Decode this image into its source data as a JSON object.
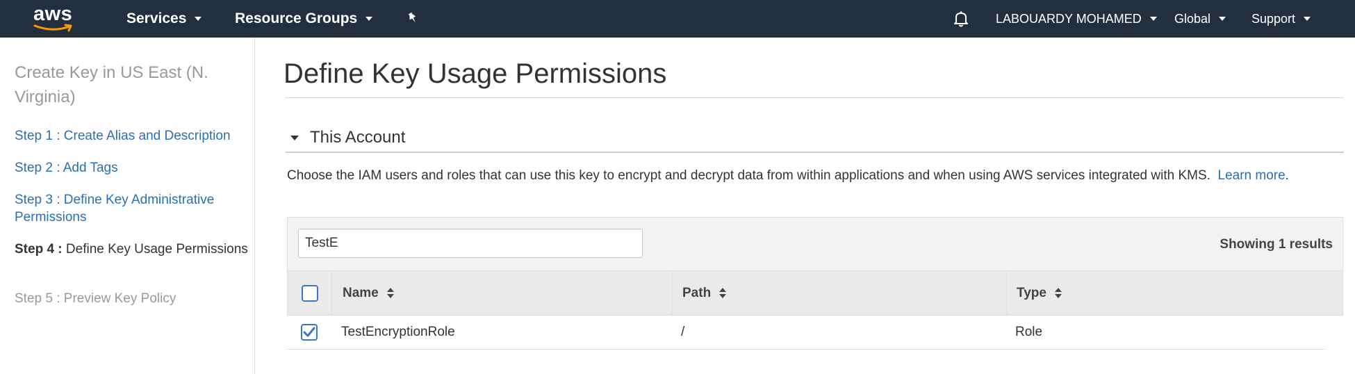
{
  "topbar": {
    "logo": "aws",
    "services": "Services",
    "resource_groups": "Resource Groups",
    "pin_icon": "pin-icon",
    "bell_icon": "bell-icon",
    "user": "LABOUARDY MOHAMED",
    "region": "Global",
    "support": "Support"
  },
  "sidebar": {
    "title": "Create Key in US East (N. Virginia)",
    "steps": [
      {
        "number": "Step 1 :",
        "label": "Create Alias and Description"
      },
      {
        "number": "Step 2 :",
        "label": "Add Tags"
      },
      {
        "number": "Step 3 :",
        "label": "Define Key Administrative Permissions"
      },
      {
        "number": "Step 4 :",
        "label": "Define Key Usage Permissions"
      },
      {
        "number": "Step 5 :",
        "label": "Preview Key Policy"
      }
    ],
    "current_step": 4
  },
  "main": {
    "title": "Define Key Usage Permissions",
    "section": "This Account",
    "description": "Choose the IAM users and roles that can use this key to encrypt and decrypt data from within applications and when using AWS services integrated with KMS.",
    "learn_more": "Learn more",
    "desc_end": "."
  },
  "table": {
    "search_value": "TestE",
    "results": "Showing 1 results",
    "columns": [
      "Name",
      "Path",
      "Type"
    ],
    "rows": [
      {
        "checked": true,
        "name": "TestEncryptionRole",
        "path": "/",
        "type": "Role"
      }
    ]
  },
  "colors": {
    "topbar": "#232f3e",
    "link": "#2b6fb0",
    "checkbox": "#3b78c3"
  }
}
